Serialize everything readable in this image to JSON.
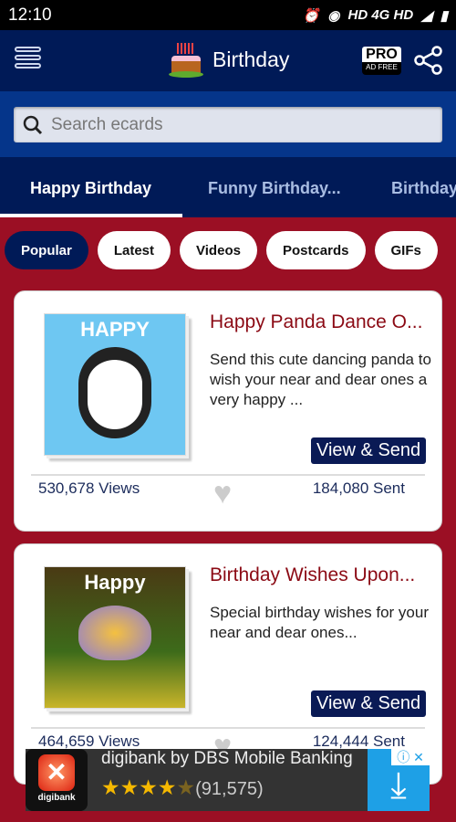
{
  "status": {
    "time": "12:10",
    "network": "HD 4G HD"
  },
  "header": {
    "title": "Birthday",
    "pro_label": "PRO",
    "pro_sub": "AD FREE"
  },
  "search": {
    "placeholder": "Search ecards"
  },
  "tabs": [
    {
      "label": "Happy Birthday",
      "active": true
    },
    {
      "label": "Funny Birthday..."
    },
    {
      "label": "Birthday"
    }
  ],
  "chips": [
    {
      "label": "Popular",
      "active": true
    },
    {
      "label": "Latest"
    },
    {
      "label": "Videos"
    },
    {
      "label": "Postcards"
    },
    {
      "label": "GIFs"
    }
  ],
  "cards": [
    {
      "thumb_text": "HAPPY",
      "title": "Happy Panda Dance O...",
      "desc": "Send this cute dancing panda to wish your near and dear ones a very happy ...",
      "button": "View & Send",
      "views": "530,678 Views",
      "sent": "184,080 Sent"
    },
    {
      "thumb_text": "Happy",
      "title": "Birthday Wishes Upon...",
      "desc": "Special birthday wishes for your near and dear ones...",
      "button": "View & Send",
      "views": "464,659 Views",
      "sent": "124,444 Sent"
    }
  ],
  "ad": {
    "logo_text": "digibank",
    "title": "digibank by DBS Mobile Banking",
    "rating": 4,
    "rating_count": "(91,575)"
  },
  "colors": {
    "header": "#001a57",
    "search_band": "#05358a",
    "background": "#9b0f24",
    "title": "#8b0a14"
  }
}
